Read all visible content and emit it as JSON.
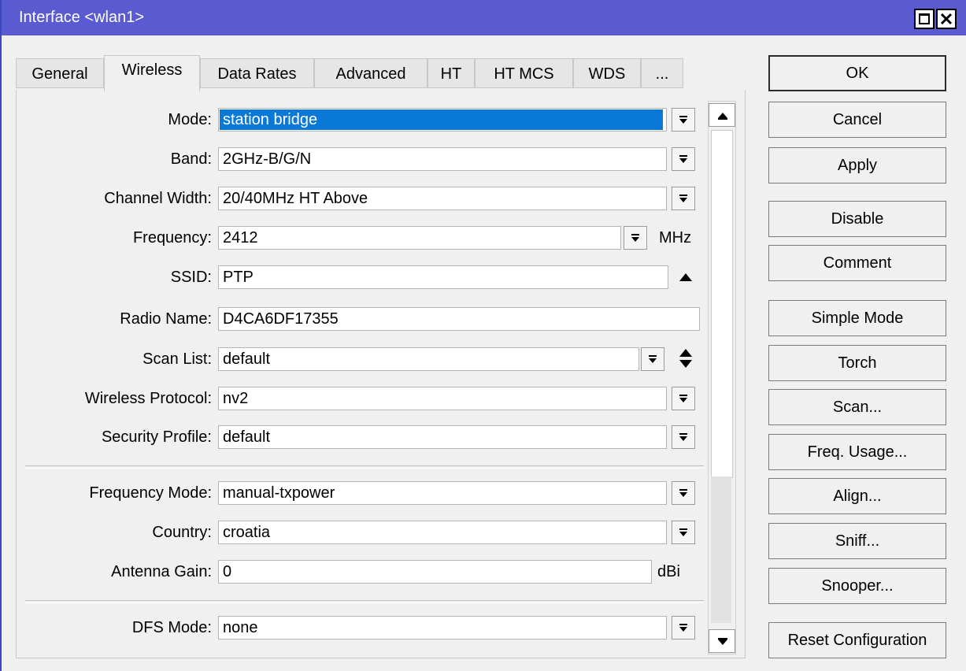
{
  "window": {
    "title": "Interface <wlan1>"
  },
  "tabs": [
    {
      "label": "General"
    },
    {
      "label": "Wireless"
    },
    {
      "label": "Data Rates"
    },
    {
      "label": "Advanced"
    },
    {
      "label": "HT"
    },
    {
      "label": "HT MCS"
    },
    {
      "label": "WDS"
    },
    {
      "label": "..."
    }
  ],
  "active_tab": "Wireless",
  "fields": {
    "mode": {
      "label": "Mode:",
      "value": "station bridge"
    },
    "band": {
      "label": "Band:",
      "value": "2GHz-B/G/N"
    },
    "channel_width": {
      "label": "Channel Width:",
      "value": "20/40MHz HT Above"
    },
    "frequency": {
      "label": "Frequency:",
      "value": "2412",
      "unit": "MHz"
    },
    "ssid": {
      "label": "SSID:",
      "value": "PTP"
    },
    "radio_name": {
      "label": "Radio Name:",
      "value": "D4CA6DF17355"
    },
    "scan_list": {
      "label": "Scan List:",
      "value": "default"
    },
    "wireless_protocol": {
      "label": "Wireless Protocol:",
      "value": "nv2"
    },
    "security_profile": {
      "label": "Security Profile:",
      "value": "default"
    },
    "frequency_mode": {
      "label": "Frequency Mode:",
      "value": "manual-txpower"
    },
    "country": {
      "label": "Country:",
      "value": "croatia"
    },
    "antenna_gain": {
      "label": "Antenna Gain:",
      "value": "0",
      "unit": "dBi"
    },
    "dfs_mode": {
      "label": "DFS Mode:",
      "value": "none"
    }
  },
  "buttons": {
    "ok": "OK",
    "cancel": "Cancel",
    "apply": "Apply",
    "disable": "Disable",
    "comment": "Comment",
    "simple_mode": "Simple Mode",
    "torch": "Torch",
    "scan": "Scan...",
    "freq_usage": "Freq. Usage...",
    "align": "Align...",
    "sniff": "Sniff...",
    "snooper": "Snooper...",
    "reset_configuration": "Reset Configuration"
  },
  "colors": {
    "titlebar": "#5a5ad1",
    "selection": "#0a78d7"
  }
}
